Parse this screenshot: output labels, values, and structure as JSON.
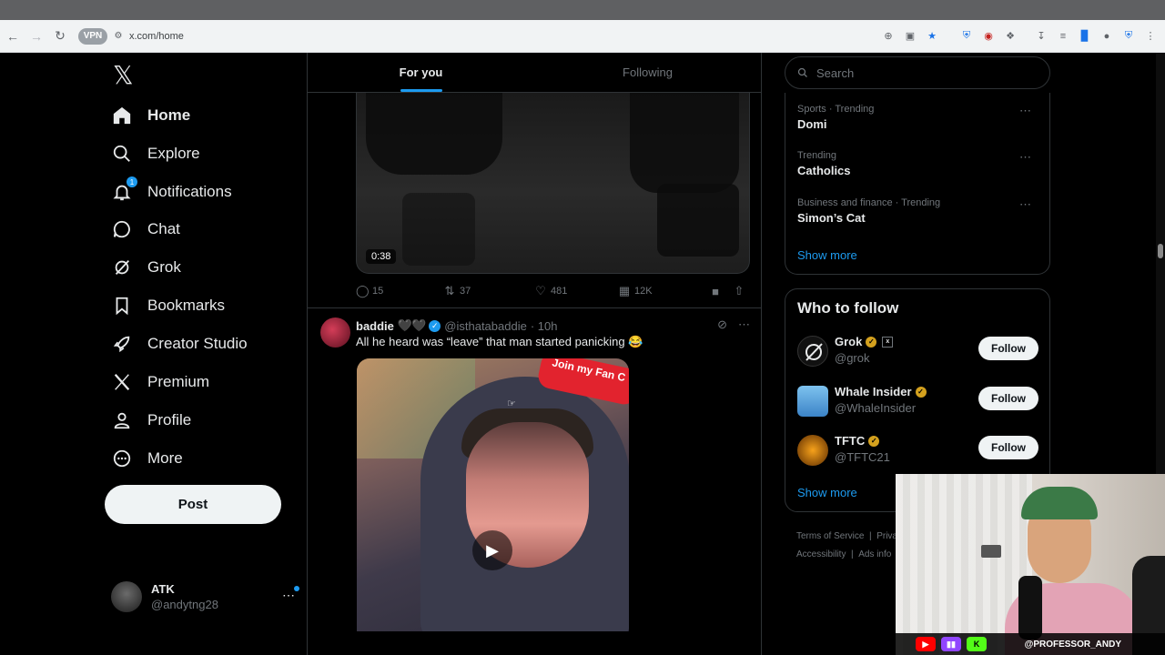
{
  "browser": {
    "url": "x.com/home",
    "vpn_label": "VPN",
    "icons": [
      "zoom-icon",
      "install-icon",
      "star-icon",
      "shield-icon",
      "ublock-icon",
      "extensions-icon",
      "download-icon",
      "reading-list-icon",
      "sidebar-icon",
      "profile-icon",
      "vpn-shield-icon",
      "menu-icon"
    ]
  },
  "nav": {
    "items": [
      {
        "label": "Home",
        "icon": "home-icon"
      },
      {
        "label": "Explore",
        "icon": "search-icon"
      },
      {
        "label": "Notifications",
        "icon": "bell-icon",
        "badge": "1"
      },
      {
        "label": "Chat",
        "icon": "chat-icon"
      },
      {
        "label": "Grok",
        "icon": "grok-icon"
      },
      {
        "label": "Bookmarks",
        "icon": "bookmark-icon"
      },
      {
        "label": "Creator Studio",
        "icon": "rocket-icon"
      },
      {
        "label": "Premium",
        "icon": "x-logo-icon"
      },
      {
        "label": "Profile",
        "icon": "person-icon"
      },
      {
        "label": "More",
        "icon": "more-circle-icon"
      }
    ],
    "post_label": "Post",
    "account": {
      "name": "ATK",
      "handle": "@andytng28"
    }
  },
  "feed": {
    "tabs": [
      {
        "label": "For you",
        "active": true
      },
      {
        "label": "Following",
        "active": false
      }
    ],
    "video1": {
      "duration": "0:38"
    },
    "stats": {
      "replies": "15",
      "reposts": "37",
      "likes": "481",
      "views": "12K"
    },
    "tweet2": {
      "name": "baddie",
      "name_suffix": "🖤🖤",
      "handle": "@isthatabaddie",
      "time": "· 10h",
      "text": "All he heard was “leave” that man started panicking 😂",
      "video_tag": "Join my Fan C"
    }
  },
  "right": {
    "search_placeholder": "Search",
    "trends": [
      {
        "category": "Sports · Trending",
        "title": "Domi"
      },
      {
        "category": "Trending",
        "title": "Catholics"
      },
      {
        "category": "Business and finance · Trending",
        "title": "Simon’s Cat"
      }
    ],
    "show_more": "Show more",
    "who_to_follow": {
      "title": "Who to follow",
      "accounts": [
        {
          "name": "Grok",
          "handle": "@grok",
          "follow": "Follow"
        },
        {
          "name": "Whale Insider",
          "handle": "@WhaleInsider",
          "follow": "Follow"
        },
        {
          "name": "TFTC",
          "handle": "@TFTC21",
          "follow": "Follow"
        }
      ],
      "show_more": "Show more"
    },
    "footer": {
      "terms": "Terms of Service",
      "sep1": "|",
      "privacy": "Priva",
      "accessibility": "Accessibility",
      "sep2": "|",
      "ads": "Ads info"
    }
  },
  "webcam": {
    "handle": "@PROFESSOR_ANDY",
    "colors": {
      "youtube": "#ff0000",
      "twitch": "#9146ff",
      "kick": "#53fc18"
    }
  }
}
